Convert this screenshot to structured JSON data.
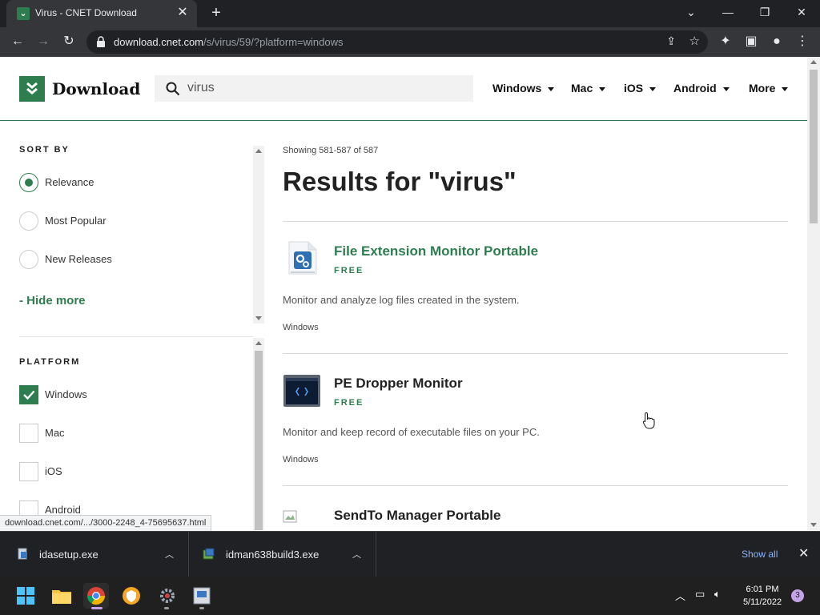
{
  "browser": {
    "tab_title": "Virus - CNET Download",
    "url_host": "download.cnet.com",
    "url_path": "/s/virus/59/?platform=windows"
  },
  "header": {
    "logo_text": "Download",
    "search_value": "virus",
    "nav": [
      "Windows",
      "Mac",
      "iOS",
      "Android",
      "More"
    ]
  },
  "sidebar": {
    "sort_title": "SORT BY",
    "sort_options": [
      "Relevance",
      "Most Popular",
      "New Releases"
    ],
    "sort_selected": "Relevance",
    "hide_more": "-  Hide more",
    "platform_title": "PLATFORM",
    "platforms": [
      "Windows",
      "Mac",
      "iOS",
      "Android"
    ],
    "platform_checked": "Windows"
  },
  "results": {
    "showing": "Showing 581-587 of 587",
    "title": "Results for \"virus\"",
    "items": [
      {
        "name": "File Extension Monitor Portable",
        "price": "FREE",
        "description": "Monitor and analyze log files created in the system.",
        "platform": "Windows",
        "icon": "gear-document-icon",
        "highlighted": true
      },
      {
        "name": "PE Dropper Monitor",
        "price": "FREE",
        "description": "Monitor and keep record of executable files on your PC.",
        "platform": "Windows",
        "icon": "monitor-window-icon",
        "highlighted": false
      },
      {
        "name": "SendTo Manager Portable",
        "price": "",
        "description": "",
        "platform": "",
        "icon": "broken-image-icon",
        "highlighted": false
      }
    ]
  },
  "statusbar": {
    "link": "download.cnet.com/.../3000-2248_4-75695637.html"
  },
  "downloads": {
    "items": [
      "idasetup.exe",
      "idman638build3.exe"
    ],
    "show_all": "Show all"
  },
  "taskbar": {
    "time": "6:01 PM",
    "date": "5/11/2022",
    "notifications": "3"
  },
  "colors": {
    "brand_green": "#2e7d4f",
    "chrome_dark": "#202124",
    "chrome_toolbar": "#35363a",
    "link_blue": "#8ab4f8"
  }
}
